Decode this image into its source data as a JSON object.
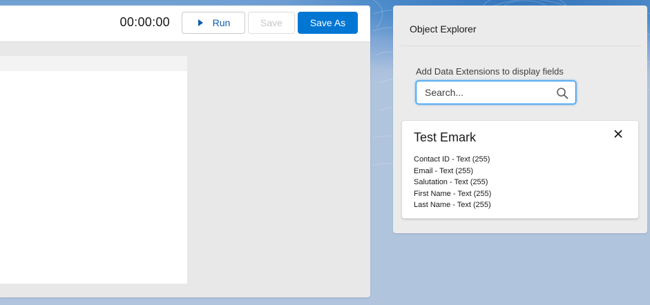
{
  "toolbar": {
    "timer": "00:00:00",
    "run_label": "Run",
    "save_label": "Save",
    "save_as_label": "Save As"
  },
  "explorer": {
    "title": "Object Explorer",
    "search_label": "Add Data Extensions to display fields",
    "search_placeholder": "Search...",
    "search_value": "",
    "data_extension": {
      "name": "Test Emark",
      "fields": [
        "Contact ID - Text (255)",
        "Email - Text (255)",
        "Salutation - Text (255)",
        "First Name - Text (255)",
        "Last Name - Text (255)"
      ]
    }
  },
  "colors": {
    "brand_blue": "#0176d3",
    "link_blue": "#0b5cab",
    "disabled_text": "#c9c7c5",
    "background": "#b0c4de"
  },
  "icons": {
    "run": "play-icon",
    "search": "search-icon",
    "close": "close-icon"
  }
}
